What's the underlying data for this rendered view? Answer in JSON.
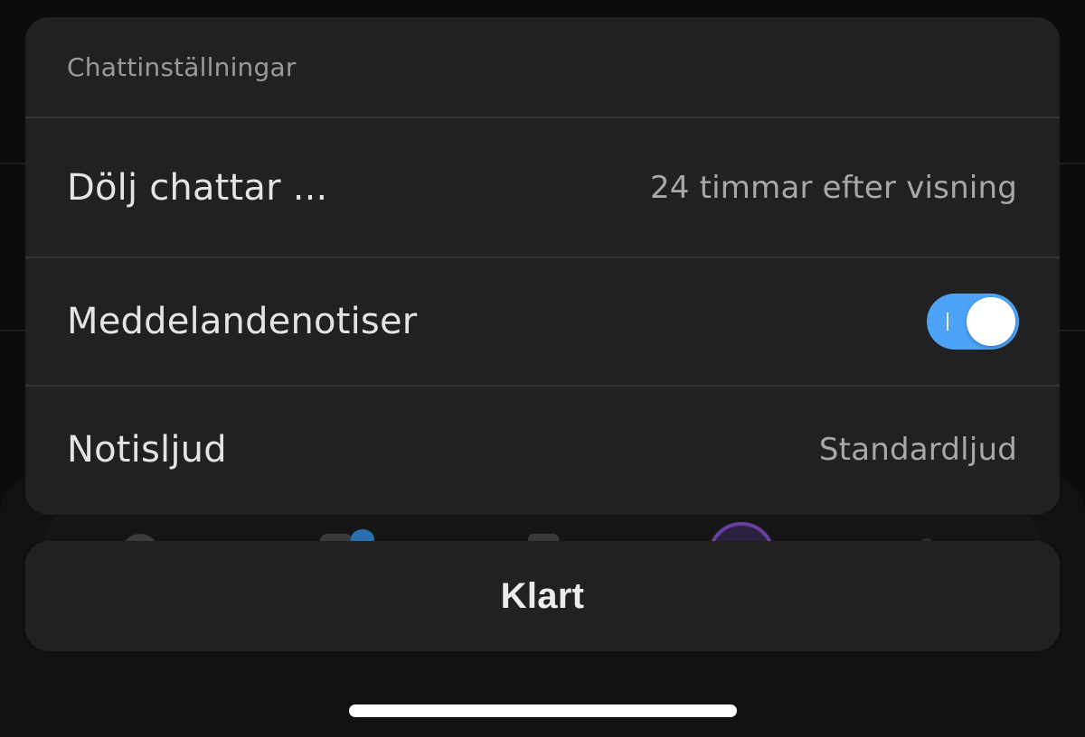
{
  "sheet": {
    "title": "Chattinställningar",
    "rows": [
      {
        "label": "Dölj chattar ...",
        "value": "24 timmar efter visning"
      },
      {
        "label": "Meddelandenotiser",
        "toggle_on": true
      },
      {
        "label": "Notisljud",
        "value": "Standardljud"
      }
    ]
  },
  "done_button": {
    "label": "Klart"
  },
  "colors": {
    "sheet_background": "#212121",
    "toggle_on": "#4da3f7",
    "screen_background": "#0c0c0c"
  }
}
